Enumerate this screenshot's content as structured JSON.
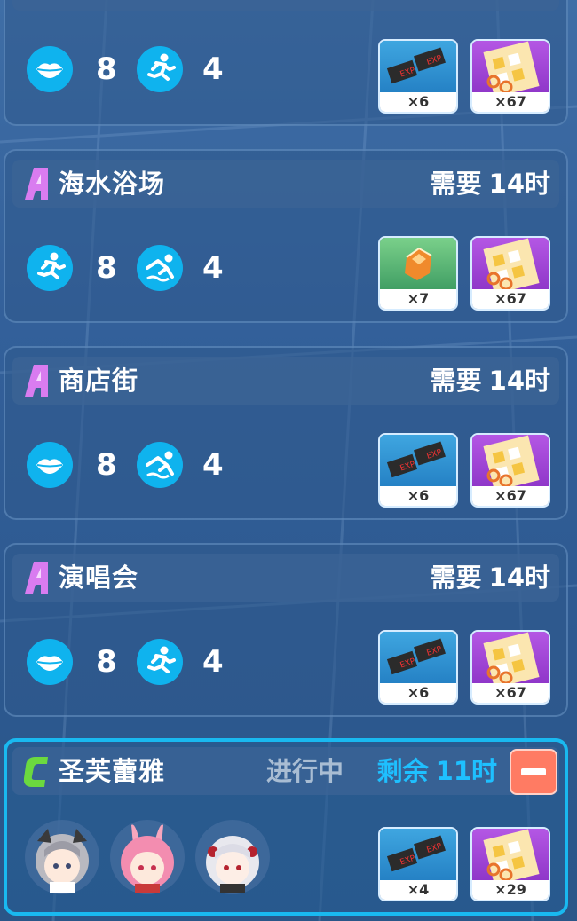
{
  "cards": [
    {
      "title": "",
      "requirements": [
        {
          "icon": "lips-icon",
          "count": "8"
        },
        {
          "icon": "running-icon",
          "count": "4"
        }
      ],
      "rewards": [
        {
          "icon": "exp-chip-icon",
          "count": "×6"
        },
        {
          "icon": "point-card-icon",
          "count": "×67"
        }
      ]
    },
    {
      "rank": "A",
      "title": "海水浴场",
      "need_label": "需要",
      "need_value": "14时",
      "requirements": [
        {
          "icon": "running-icon",
          "count": "8"
        },
        {
          "icon": "swimming-icon",
          "count": "4"
        }
      ],
      "rewards": [
        {
          "icon": "crystal-icon",
          "count": "×7"
        },
        {
          "icon": "point-card-icon",
          "count": "×67"
        }
      ]
    },
    {
      "rank": "A",
      "title": "商店街",
      "need_label": "需要",
      "need_value": "14时",
      "requirements": [
        {
          "icon": "lips-icon",
          "count": "8"
        },
        {
          "icon": "swimming-icon",
          "count": "4"
        }
      ],
      "rewards": [
        {
          "icon": "exp-chip-icon",
          "count": "×6"
        },
        {
          "icon": "point-card-icon",
          "count": "×67"
        }
      ]
    },
    {
      "rank": "A",
      "title": "演唱会",
      "need_label": "需要",
      "need_value": "14时",
      "requirements": [
        {
          "icon": "lips-icon",
          "count": "8"
        },
        {
          "icon": "running-icon",
          "count": "4"
        }
      ],
      "rewards": [
        {
          "icon": "exp-chip-icon",
          "count": "×6"
        },
        {
          "icon": "point-card-icon",
          "count": "×67"
        }
      ]
    }
  ],
  "active_card": {
    "rank": "C",
    "title": "圣芙蕾雅",
    "status": "进行中",
    "remain_label": "剩余",
    "remain_value": "11时",
    "avatars": [
      "avatar-grey-hair",
      "avatar-pink-bunny",
      "avatar-white-hair"
    ],
    "rewards": [
      {
        "icon": "exp-chip-icon",
        "count": "×4"
      },
      {
        "icon": "point-card-icon",
        "count": "×29"
      }
    ]
  },
  "colors": {
    "rank_a": "#d97cf0",
    "rank_c": "#6bd93f",
    "accent": "#19b9f0",
    "minus": "#ff7b63"
  }
}
